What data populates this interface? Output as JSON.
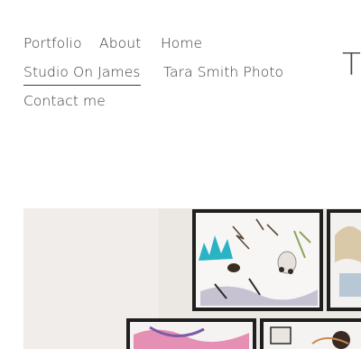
{
  "nav": {
    "items": [
      {
        "label": "Portfolio"
      },
      {
        "label": "About"
      },
      {
        "label": "Home"
      },
      {
        "label": "Studio On James",
        "active": true
      },
      {
        "label": "Tara Smith Photo"
      },
      {
        "label": "Contact me"
      }
    ]
  },
  "logo": {
    "text": "T"
  },
  "colors": {
    "text": "#3a3a3a",
    "wall": "#ece9e5",
    "frame": "#1f1f1f",
    "accent_teal": "#29b3c4"
  },
  "hero": {
    "icon": "gallery-wall-image"
  }
}
